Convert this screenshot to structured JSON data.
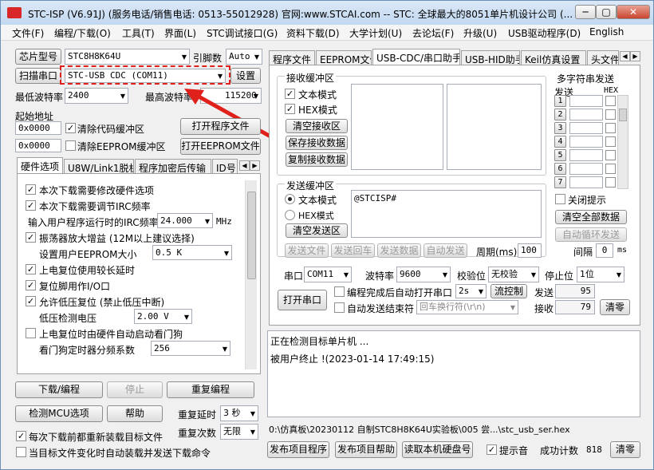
{
  "window": {
    "title": "STC-ISP (V6.91J) (服务电话/销售电话: 0513-55012928) 官网:www.STCAI.com  -- STC: 全球最大的8051单片机设计公司 (...",
    "controls": [
      "─",
      "▢",
      "✕"
    ]
  },
  "menu": [
    "文件(F)",
    "编程/下载(O)",
    "工具(T)",
    "界面(L)",
    "STC调试接口(G)",
    "资料下载(D)",
    "大学计划(U)",
    "去论坛(F)",
    "升级(U)",
    "USB驱动程序(D)",
    "English"
  ],
  "left": {
    "chip_button": "芯片型号",
    "chip_value": "STC8H8K64U",
    "pins_label": "引脚数",
    "pins_value": "Auto",
    "scan_button": "扫描串口",
    "port_value": "STC-USB CDC (COM11)",
    "settings_button": "设置",
    "min_baud_label": "最低波特率",
    "min_baud_value": "2400",
    "max_baud_label": "最高波特率",
    "max_baud_value": "115200",
    "start_addr_label": "起始地址",
    "addr1": "0x0000",
    "clear_code_label": "清除代码缓冲区",
    "open_program_button": "打开程序文件",
    "addr2": "0x0000",
    "clear_eeprom_label": "清除EEPROM缓冲区",
    "open_eeprom_button": "打开EEPROM文件",
    "tabs": [
      "硬件选项",
      "U8W/Link1脱机",
      "程序加密后传输",
      "ID号"
    ],
    "options": {
      "opt1": "本次下载需要修改硬件选项",
      "opt2": "本次下载需要调节IRC频率",
      "irc_label": "输入用户程序运行时的IRC频率",
      "irc_value": "24.000",
      "irc_unit": "MHz",
      "opt3": "振荡器放大增益 (12M以上建议选择)",
      "eeprom_size_label": "设置用户EEPROM大小",
      "eeprom_size_value": "0.5 K",
      "opt4": "上电复位使用较长延时",
      "opt5": "复位脚用作I/O口",
      "opt6": "允许低压复位 (禁止低压中断)",
      "lv_label": "低压检测电压",
      "lv_value": "2.00 V",
      "opt7": "上电复位时由硬件自动启动看门狗",
      "wdt_label": "看门狗定时器分频系数",
      "wdt_value": "256"
    },
    "download_button": "下载/编程",
    "stop_button": "停止",
    "reprogram_button": "重复编程",
    "detect_button": "检测MCU选项",
    "help_button": "帮助",
    "repeat_delay_label": "重复延时",
    "repeat_delay_value": "3 秒",
    "repeat_count_label": "重复次数",
    "repeat_count_value": "无限",
    "reload_label": "每次下载前都重新装载目标文件",
    "auto_load_label": "当目标文件变化时自动装载并发送下载命令"
  },
  "right": {
    "tabs": [
      "程序文件",
      "EEPROM文件",
      "USB-CDC/串口助手",
      "USB-HID助手",
      "Keil仿真设置",
      "头文件"
    ],
    "recv_group": "接收缓冲区",
    "recv_text_mode": "文本模式",
    "recv_hex_mode": "HEX模式",
    "clear_recv_button": "清空接收区",
    "save_recv_button": "保存接收数据",
    "copy_recv_button": "复制接收数据",
    "send_group": "发送缓冲区",
    "send_text_mode": "文本模式",
    "send_hex_mode": "HEX模式",
    "clear_send_button": "清空发送区",
    "send_content": "@STCISP#",
    "send_file_button": "发送文件",
    "send_return_button": "发送回车",
    "send_data_button": "发送数据",
    "auto_send_button": "自动发送",
    "period_label": "周期(ms)",
    "period_value": "100",
    "multi_group": "多字符串发送",
    "multi_send_label": "发送",
    "multi_hex_label": "HEX",
    "multi_rows": [
      "1",
      "2",
      "3",
      "4",
      "5",
      "6",
      "7"
    ],
    "close_prompt_label": "关闭提示",
    "clear_all_button": "清空全部数据",
    "auto_loop_button": "自动循环发送",
    "interval_label": "间隔",
    "interval_value": "0",
    "interval_unit": "ms",
    "serial_label": "串口",
    "serial_value": "COM11",
    "baud_label": "波特率",
    "baud_value": "9600",
    "parity_label": "校验位",
    "parity_value": "无校验",
    "stop_bits_label": "停止位",
    "stop_bits_value": "1位",
    "open_port_button": "打开串口",
    "auto_open_label": "编程完成后自动打开串口",
    "auto_open_delay": "2s",
    "flow_button": "流控制",
    "sent_label": "发送",
    "sent_count": "95",
    "auto_send_end_label": "自动发送结束符",
    "newline_value": "回车换行符(\\r\\n)",
    "recv_label": "接收",
    "recv_count": "79",
    "clear_count_button": "清零",
    "log_line1": "正在检测目标单片机 ...",
    "log_line2": "被用户终止 !(2023-01-14 17:49:15)",
    "path": "0:\\仿真板\\20230112 自制STC8H8K64U实验板\\005 尝...\\stc_usb_ser.hex",
    "publish_button": "发布项目程序",
    "publish_help_button": "发布项目帮助",
    "read_disk_button": "读取本机硬盘号",
    "sound_label": "提示音",
    "success_label": "成功计数",
    "success_count": "818",
    "clear_success_button": "清零"
  },
  "colors": {
    "highlight": "#e0201a",
    "titlebar": "#c9dcf2"
  }
}
